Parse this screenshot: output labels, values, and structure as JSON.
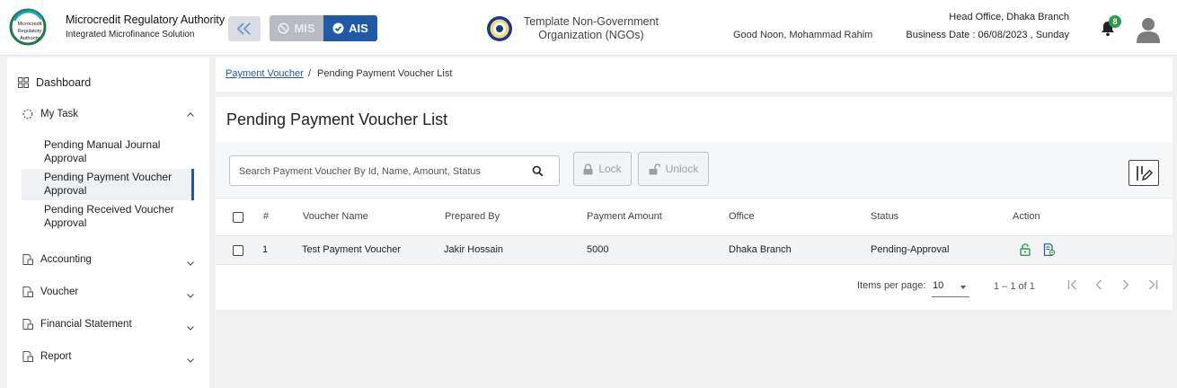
{
  "header": {
    "org_name": "Microcredit Regulatory Authority",
    "org_subtitle": "Integrated Microfinance Solution",
    "logo_text": "Microcredit Regulatory Authority",
    "mis_label": "MIS",
    "ais_label": "AIS",
    "ngo_line1": "Template Non-Government",
    "ngo_line2": "Organization (NGOs)",
    "greeting": "Good Noon, Mohammad Rahim",
    "branch": "Head Office, Dhaka Branch",
    "business_date": "Business Date : 06/08/2023 , Sunday",
    "notification_count": "8",
    "accent_color": "#1e5aa6",
    "badge_color": "#2e9b4a"
  },
  "sidebar": {
    "dashboard": "Dashboard",
    "my_task": "My Task",
    "my_task_items": [
      "Pending Manual Journal Approval",
      "Pending Payment Voucher Approval",
      "Pending Received Voucher Approval"
    ],
    "active_item": "Pending Payment Voucher Approval",
    "accounting": "Accounting",
    "voucher": "Voucher",
    "financial_statement": "Financial Statement",
    "report": "Report"
  },
  "breadcrumb": {
    "parent": "Payment Voucher",
    "separator": "/",
    "current": "Pending Payment Voucher List"
  },
  "main": {
    "title": "Pending Payment Voucher List",
    "search_placeholder": "Search Payment Voucher By Id, Name, Amount, Status",
    "lock_label": "Lock",
    "unlock_label": "Unlock"
  },
  "table": {
    "columns": [
      "#",
      "Voucher Name",
      "Prepared By",
      "Payment Amount",
      "Office",
      "Status",
      "Action"
    ],
    "rows": [
      {
        "no": "1",
        "voucher_name": "Test Payment Voucher",
        "prepared_by": "Jakir Hossain",
        "payment_amount": "5000",
        "office": "Dhaka Branch",
        "status": "Pending-Approval",
        "actions": [
          "unlock-icon",
          "view-details-icon"
        ]
      }
    ]
  },
  "paginator": {
    "items_per_page_label": "Items per page:",
    "items_per_page": "10",
    "range": "1 – 1 of 1"
  }
}
